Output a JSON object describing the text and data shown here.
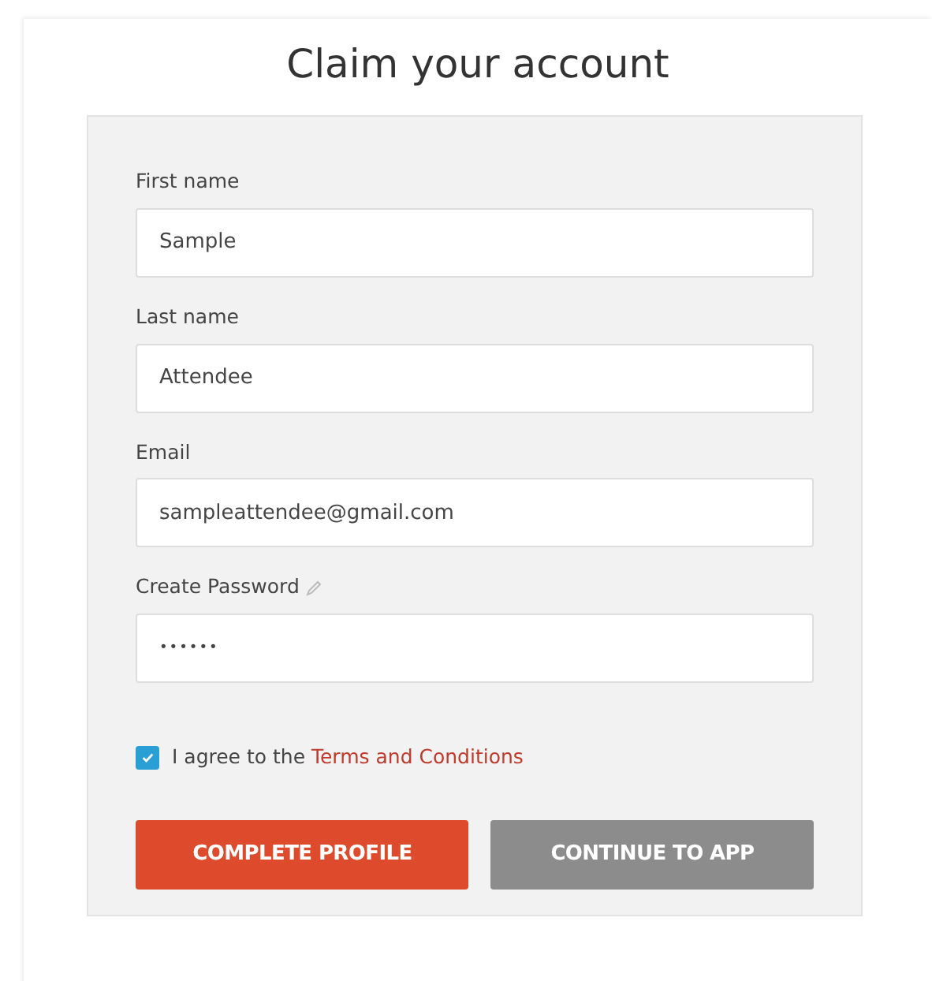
{
  "title": "Claim your account",
  "fields": [
    {
      "label": "First name",
      "value": "Sample"
    },
    {
      "label": "Last name",
      "value": "Attendee"
    },
    {
      "label": "Email",
      "value": "sampleattendee@gmail.com"
    },
    {
      "label": "Create Password",
      "value": "••••••",
      "kind": "password"
    }
  ],
  "agreement": {
    "checked": true,
    "text": "I agree to the",
    "link": "Terms and Conditions"
  },
  "buttons": [
    {
      "label": "COMPLETE PROFILE",
      "kind": "primary"
    },
    {
      "label": "CONTINUE TO APP",
      "kind": "secondary"
    }
  ]
}
